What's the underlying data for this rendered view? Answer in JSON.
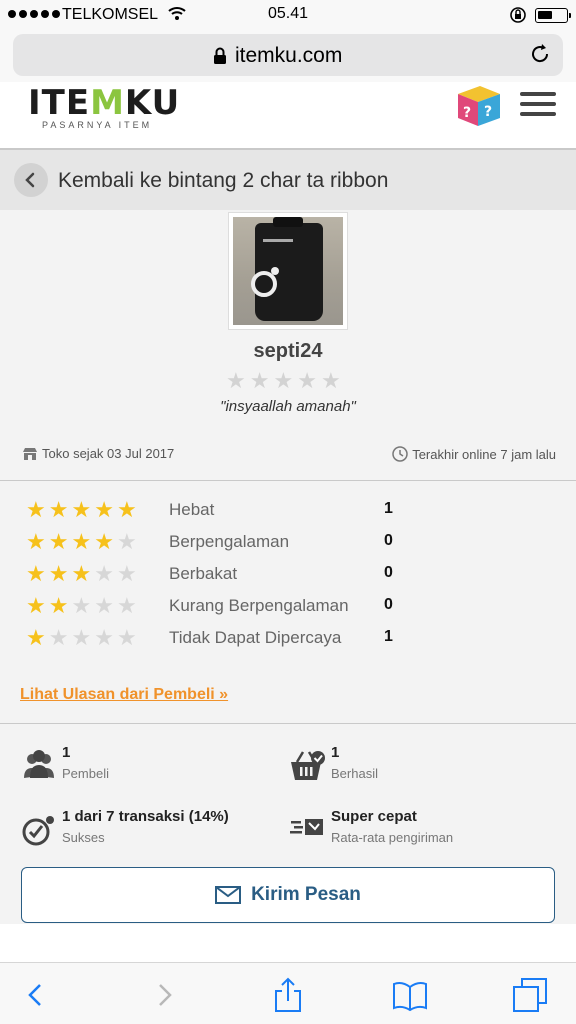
{
  "status_bar": {
    "carrier": "TELKOMSEL",
    "time": "05.41"
  },
  "browser": {
    "url": "itemku.com"
  },
  "header": {
    "logo_text_part1": "ITE",
    "logo_text_m": "M",
    "logo_text_part2": "KU",
    "logo_tagline": "PASARNYA ITEM"
  },
  "back_bar": {
    "title": "Kembali ke bintang 2 char ta ribbon"
  },
  "seller": {
    "name": "septi24",
    "rating_stars": 0,
    "quote": "\"insyaallah amanah\"",
    "store_since": "Toko sejak 03 Jul 2017",
    "last_online": "Terakhir online 7 jam lalu"
  },
  "ratings": [
    {
      "stars": 5,
      "label": "Hebat",
      "count": "1"
    },
    {
      "stars": 4,
      "label": "Berpengalaman",
      "count": "0"
    },
    {
      "stars": 3,
      "label": "Berbakat",
      "count": "0"
    },
    {
      "stars": 2,
      "label": "Kurang Berpengalaman",
      "count": "0"
    },
    {
      "stars": 1,
      "label": "Tidak Dapat Dipercaya",
      "count": "1"
    }
  ],
  "reviews_link": "Lihat Ulasan dari Pembeli »",
  "stats": {
    "buyers_value": "1",
    "buyers_label": "Pembeli",
    "success_value": "1",
    "success_label": "Berhasil",
    "tx_value": "1 dari 7 transaksi (14%)",
    "tx_label": "Sukses",
    "shipping_value": "Super cepat",
    "shipping_label": "Rata-rata pengiriman"
  },
  "message_button": "Kirim Pesan",
  "colors": {
    "accent": "#f0922b",
    "primary": "#2a5d84",
    "star": "#f6c11b"
  }
}
